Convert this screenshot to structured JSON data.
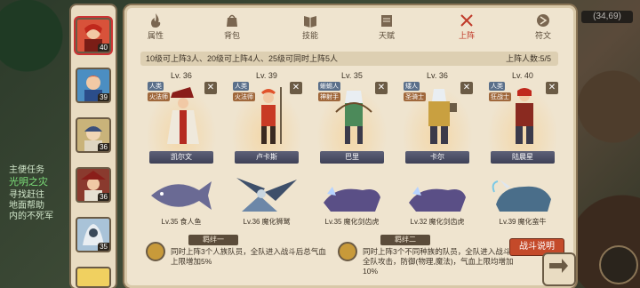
{
  "left_texts": [
    "主便任务",
    "光明之灾",
    "寻找赶往",
    "地面帮助",
    "内的不死军"
  ],
  "coord": "(34,69)",
  "hero_list": [
    {
      "level": "40",
      "selected": true
    },
    {
      "level": "39"
    },
    {
      "level": "36"
    },
    {
      "level": "36"
    },
    {
      "level": "35"
    }
  ],
  "tabs": [
    {
      "label": "属性"
    },
    {
      "label": "背包"
    },
    {
      "label": "技能"
    },
    {
      "label": "天赋"
    },
    {
      "label": "上阵"
    },
    {
      "label": "符文"
    }
  ],
  "notice": {
    "text": "10级可上阵3人、20级可上阵4人、25级可同时上阵5人",
    "count": "上阵人数:5/5"
  },
  "slots": [
    {
      "level": "Lv. 36",
      "race": "人类",
      "cls": "火法师",
      "name": "凯尔文"
    },
    {
      "level": "Lv. 39",
      "race": "人类",
      "cls": "火法师",
      "name": "卢卡斯"
    },
    {
      "level": "Lv. 35",
      "race": "蜥蜴人",
      "cls": "神射手",
      "name": "巴里"
    },
    {
      "level": "Lv. 36",
      "race": "矮人",
      "cls": "圣骑士",
      "name": "卡尔"
    },
    {
      "level": "Lv. 40",
      "race": "人类",
      "cls": "狂战士",
      "name": "陆晨星"
    }
  ],
  "beasts": [
    {
      "level": "Lv.35",
      "name": "食人鱼"
    },
    {
      "level": "Lv.36",
      "name": "魔化狮鹫"
    },
    {
      "level": "Lv.35",
      "name": "魔化剑齿虎"
    },
    {
      "level": "Lv.32",
      "name": "魔化剑齿虎"
    },
    {
      "level": "Lv.39",
      "name": "魔化蛮牛"
    }
  ],
  "bonds": [
    {
      "title": "羁绊一",
      "text": "同时上阵3个人族队员，全队进入战斗后总气血上限增加5%"
    },
    {
      "title": "羁绊二",
      "text": "同时上阵3个不同种族的队员，全队进入战斗后全队攻击，防御(物理,魔法)，气血上限均增加10%"
    }
  ],
  "fight_button": "战斗说明",
  "colors": {
    "accent": "#c44a2a",
    "panel": "#efe4cf",
    "race_tag": "#5a6f8a",
    "class_tag": "#a0683c"
  }
}
